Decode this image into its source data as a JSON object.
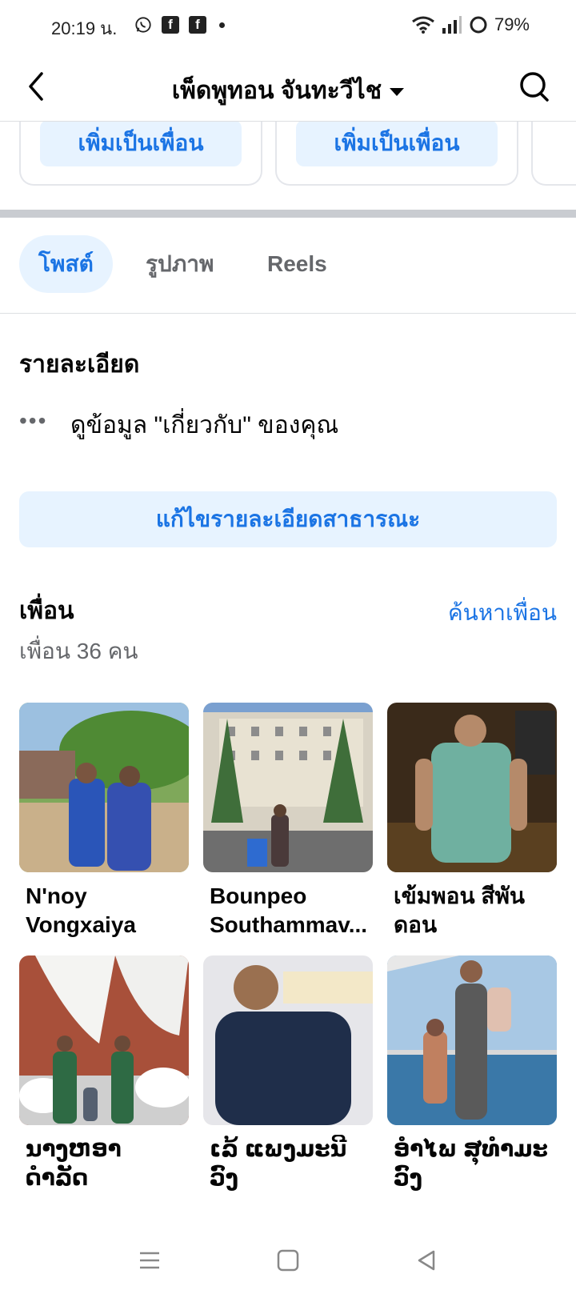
{
  "status_bar": {
    "time": "20:19 น.",
    "battery": "79%",
    "left_icons": [
      "whatsapp-icon",
      "facebook-icon",
      "facebook-icon",
      "dot-icon"
    ],
    "right_icons": [
      "wifi-icon",
      "signal-icon",
      "battery-ring-icon"
    ]
  },
  "nav": {
    "title": "เพ็ดพูทอน จันทะวีไช",
    "back_icon": "chevron-left-icon",
    "search_icon": "search-icon"
  },
  "suggestions": [
    {
      "button": "เพิ่มเป็นเพื่อน"
    },
    {
      "button": "เพิ่มเป็นเพื่อน"
    }
  ],
  "tabs": [
    {
      "label": "โพสต์",
      "active": true
    },
    {
      "label": "รูปภาพ",
      "active": false
    },
    {
      "label": "Reels",
      "active": false
    }
  ],
  "details": {
    "title": "รายละเอียด",
    "item_text": "ดูข้อมูล \"เกี่ยวกับ\" ของคุณ",
    "edit_button": "แก้ไขรายละเอียดสาธารณะ"
  },
  "friends": {
    "title": "เพื่อน",
    "find_link": "ค้นหาเพื่อน",
    "count_text": "เพื่อน 36 คน",
    "list": [
      {
        "name": "N'noy Vongxaiya"
      },
      {
        "name": "Bounpeo Southammav..."
      },
      {
        "name": "เข้มพอน สีพันดอน"
      },
      {
        "name": "ນາງຫອາ ດຳລັດ"
      },
      {
        "name": "ເລ້ ແພງມະນີວົງ"
      },
      {
        "name": "ອຳໄພ ສຸທຳມະວົງ"
      }
    ]
  },
  "system_nav": [
    "menu-icon",
    "home-square-icon",
    "back-triangle-icon"
  ],
  "colors": {
    "accent": "#1b74e4",
    "accent_bg": "#e7f3ff",
    "secondary_text": "#65676b",
    "divider": "#c9ccd1"
  }
}
